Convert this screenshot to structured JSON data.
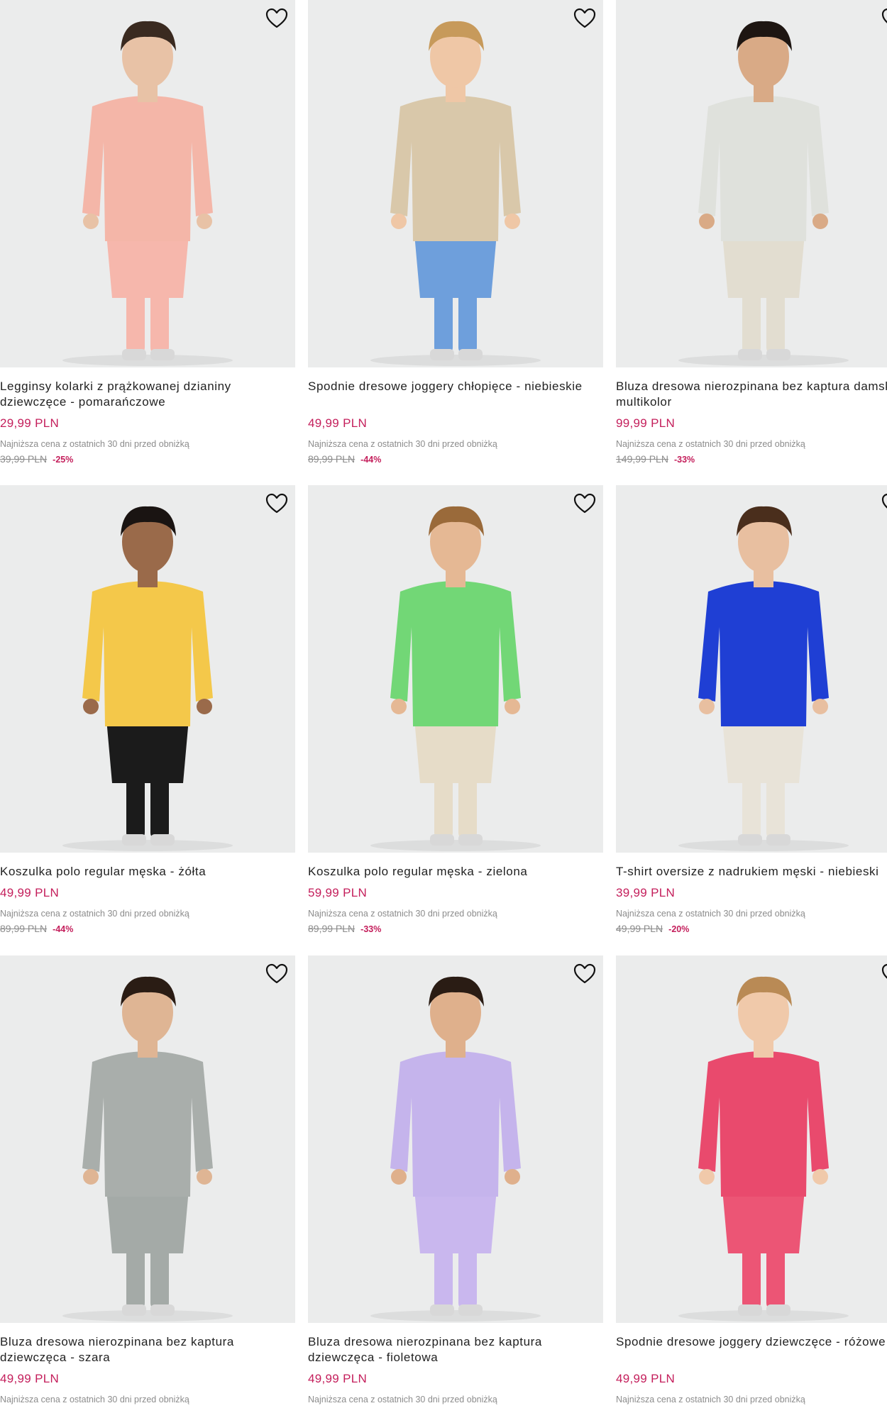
{
  "products": [
    {
      "title": "Legginsy kolarki z prążkowanej dzianiny dziewczęce - pomarańczowe",
      "price": "29,99 PLN",
      "note": "Najniższa cena z ostatnich 30 dni przed obniżką",
      "old_price": "39,99 PLN",
      "discount": "-25%",
      "colors": {
        "top": "#f4b6a8",
        "bottom": "#f6b7ac",
        "skin": "#e8c2a6",
        "hair": "#3a2a20"
      },
      "image_icon": "girl-leggings-photo"
    },
    {
      "title": "Spodnie dresowe joggery chłopięce - niebieskie",
      "price": "49,99 PLN",
      "note": "Najniższa cena z ostatnich 30 dni przed obniżką",
      "old_price": "89,99 PLN",
      "discount": "-44%",
      "colors": {
        "top": "#d9c8aa",
        "bottom": "#6e9fdc",
        "skin": "#efc7a6",
        "hair": "#c79a5b"
      },
      "image_icon": "boy-joggers-photo"
    },
    {
      "title": "Bluza dresowa nierozpinana bez kaptura damska - multikolor",
      "price": "99,99 PLN",
      "note": "Najniższa cena z ostatnich 30 dni przed obniżką",
      "old_price": "149,99 PLN",
      "discount": "-33%",
      "colors": {
        "top": "#dfe1dc",
        "bottom": "#e2ddd0",
        "skin": "#d9aa86",
        "hair": "#1e1612"
      },
      "image_icon": "woman-sweatshirt-photo"
    },
    {
      "title": "Koszulka polo regular męska - żółta",
      "price": "49,99 PLN",
      "note": "Najniższa cena z ostatnich 30 dni przed obniżką",
      "old_price": "89,99 PLN",
      "discount": "-44%",
      "colors": {
        "top": "#f4c84a",
        "bottom": "#1b1b1b",
        "skin": "#9a6a4a",
        "hair": "#1a1412"
      },
      "image_icon": "man-yellow-polo-photo"
    },
    {
      "title": "Koszulka polo regular męska - zielona",
      "price": "59,99 PLN",
      "note": "Najniższa cena z ostatnich 30 dni przed obniżką",
      "old_price": "89,99 PLN",
      "discount": "-33%",
      "colors": {
        "top": "#72d776",
        "bottom": "#e6dcc8",
        "skin": "#e5b894",
        "hair": "#9a6a3a"
      },
      "image_icon": "man-green-polo-photo"
    },
    {
      "title": "T-shirt oversize z nadrukiem męski - niebieski",
      "price": "39,99 PLN",
      "note": "Najniższa cena z ostatnich 30 dni przed obniżką",
      "old_price": "49,99 PLN",
      "discount": "-20%",
      "colors": {
        "top": "#1f3fd4",
        "bottom": "#e8e3d8",
        "skin": "#e8bfa0",
        "hair": "#4a2e1c"
      },
      "image_icon": "man-blue-tshirt-photo"
    },
    {
      "title": "Bluza dresowa nierozpinana bez kaptura dziewczęca - szara",
      "price": "49,99 PLN",
      "note": "Najniższa cena z ostatnich 30 dni przed obniżką",
      "colors": {
        "top": "#a9aeab",
        "bottom": "#a4aaa7",
        "skin": "#dfb594",
        "hair": "#2a1c14"
      },
      "image_icon": "girl-grey-sweatshirt-photo"
    },
    {
      "title": "Bluza dresowa nierozpinana bez kaptura dziewczęca - fioletowa",
      "price": "49,99 PLN",
      "note": "Najniższa cena z ostatnich 30 dni przed obniżką",
      "colors": {
        "top": "#c5b4ec",
        "bottom": "#c9b7ee",
        "skin": "#dfb08c",
        "hair": "#2a1c14"
      },
      "image_icon": "girl-violet-sweatshirt-photo"
    },
    {
      "title": "Spodnie dresowe joggery dziewczęce - różowe",
      "price": "49,99 PLN",
      "note": "Najniższa cena z ostatnich 30 dni przed obniżką",
      "colors": {
        "top": "#e94a6d",
        "bottom": "#ec5575",
        "skin": "#f0c9aa",
        "hair": "#b98a55"
      },
      "image_icon": "girl-pink-joggers-photo"
    }
  ]
}
